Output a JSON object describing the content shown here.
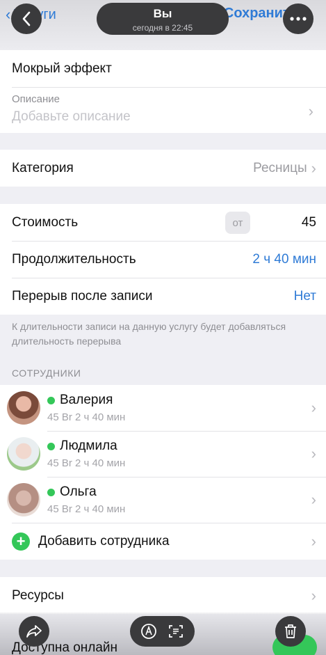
{
  "header": {
    "back_label": "Услуги",
    "save_label": "Сохранить",
    "title": "Вы",
    "subtitle": "сегодня в 22:45",
    "back_icon": "chevron-left-icon",
    "more_icon": "ellipsis-icon"
  },
  "service": {
    "name": "Мокрый эффект",
    "description_label": "Описание",
    "description_placeholder": "Добавьте описание"
  },
  "category": {
    "label": "Категория",
    "value": "Ресницы"
  },
  "pricing": {
    "cost_label": "Стоимость",
    "cost_prefix": "от",
    "cost_value": "45",
    "duration_label": "Продолжительность",
    "duration_value": "2 ч 40 мин",
    "break_label": "Перерыв после записи",
    "break_value": "Нет",
    "note": "К длительности записи на данную услугу будет добавляться длительность перерыва"
  },
  "employees": {
    "header": "СОТРУДНИКИ",
    "items": [
      {
        "name": "Валерия",
        "details": "45 Br 2 ч 40 мин"
      },
      {
        "name": "Людмила",
        "details": "45 Br 2 ч 40 мин"
      },
      {
        "name": "Ольга",
        "details": "45 Br 2 ч 40 мин"
      }
    ],
    "add_label": "Добавить сотрудника"
  },
  "resources": {
    "label": "Ресурсы"
  },
  "online": {
    "label": "Доступна онлайн",
    "enabled": true
  },
  "colors": {
    "accent": "#2f7bd6",
    "green": "#34c759",
    "overlay": "#3a3a3c"
  }
}
